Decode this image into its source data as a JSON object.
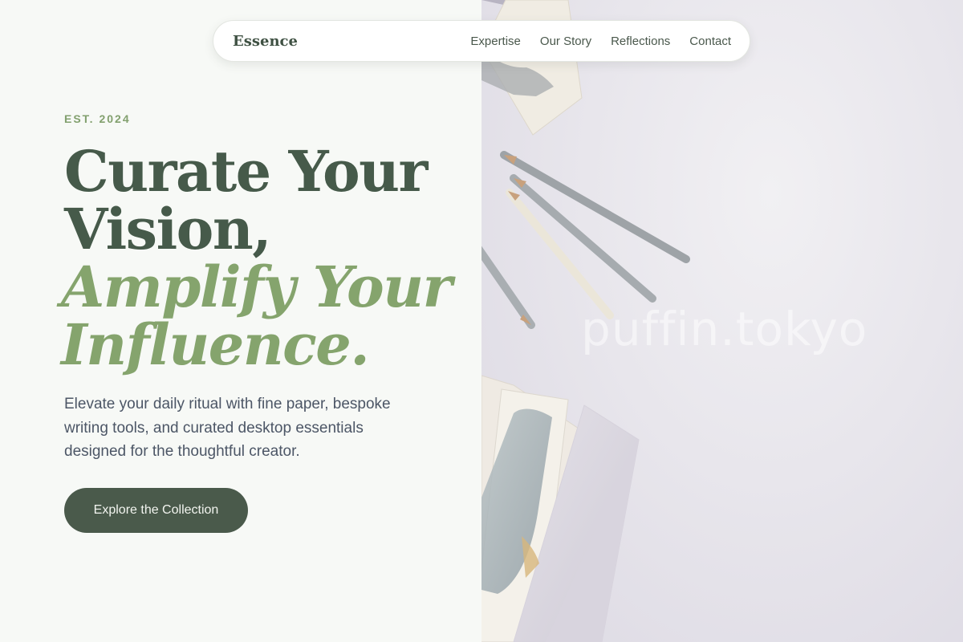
{
  "nav": {
    "brand": "Essence",
    "links": [
      "Expertise",
      "Our Story",
      "Reflections",
      "Contact"
    ]
  },
  "hero": {
    "eyebrow": "EST. 2024",
    "headline_lines": [
      "Curate Your",
      "Vision,"
    ],
    "headline_accent_lines": [
      "Amplify Your",
      "Influence."
    ],
    "lead": "Elevate your daily ritual with fine paper, bespoke writing tools, and curated desktop essentials designed for the thoughtful creator.",
    "cta_label": "Explore the Collection"
  },
  "image": {
    "watermark": "puffin.tokyo"
  },
  "colors": {
    "primary_green": "#4a5a4b",
    "accent_green": "#85a46d",
    "heading": "#465a4a",
    "body_text": "#4c5666",
    "panel_bg": "#f7f9f6"
  }
}
